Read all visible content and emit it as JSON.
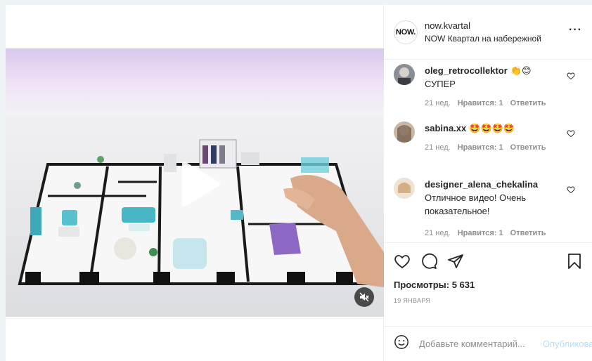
{
  "post": {
    "account": {
      "username": "now.kvartal",
      "location": "NOW Квартал на набережной",
      "avatar_text": "NOW."
    },
    "comments": [
      {
        "username": "oleg_retrocollektor",
        "text": "👏😊СУПЕР",
        "age": "21 нед.",
        "likes": "Нравится: 1",
        "reply": "Ответить"
      },
      {
        "username": "sabina.xx",
        "text": "🤩🤩🤩🤩",
        "age": "21 нед.",
        "likes": "Нравится: 1",
        "reply": "Ответить"
      },
      {
        "username": "designer_alena_chekalina",
        "text": "Отличное видео! Очень показательное!",
        "age": "21 нед.",
        "likes": "Нравится: 1",
        "reply": "Ответить"
      }
    ],
    "views": "Просмотры: 5 631",
    "date": "19 ЯНВАРЯ",
    "comment_placeholder": "Добавьте комментарий...",
    "publish_label": "Опубликовать"
  },
  "colors": {
    "accent_disabled": "#b2dffc",
    "text": "#262626",
    "muted": "#8e8e8e",
    "border": "#efefef"
  }
}
